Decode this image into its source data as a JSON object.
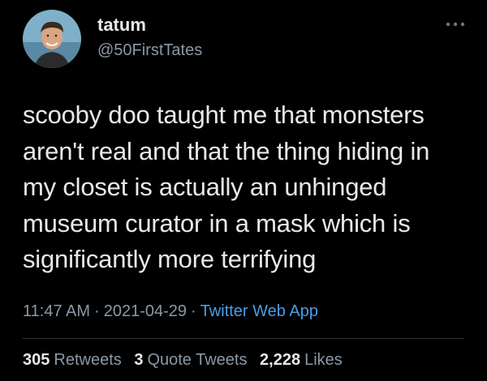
{
  "author": {
    "display_name": "tatum",
    "handle": "@50FirstTates",
    "avatar_icon": "profile-photo-icon"
  },
  "menu_icon": "more-options-icon",
  "tweet": {
    "lines": [
      "scooby doo taught me that monsters",
      "aren't real and that the thing hiding in",
      "my closet is actually an unhinged",
      "museum curator in a mask which is",
      "significantly more terrifying"
    ]
  },
  "meta": {
    "time": "11:47 AM",
    "date": "2021-04-29",
    "separator": "·",
    "source": "Twitter Web App"
  },
  "stats": {
    "retweets": {
      "count": "305",
      "label": "Retweets"
    },
    "quote_tweets": {
      "count": "3",
      "label": "Quote Tweets"
    },
    "likes": {
      "count": "2,228",
      "label": "Likes"
    }
  },
  "colors": {
    "background": "#000000",
    "primary_text": "#e7e9ea",
    "secondary_text": "#8b98a5",
    "link": "#4a9ee8",
    "divider": "#2f3336"
  }
}
